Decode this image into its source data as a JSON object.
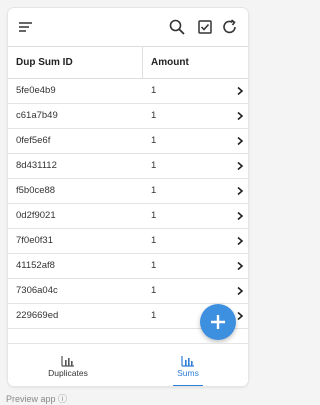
{
  "toolbar": {
    "icons": {
      "menu": "menu-icon",
      "search": "search-icon",
      "checkbox": "checkbox-icon",
      "refresh": "refresh-icon"
    }
  },
  "table": {
    "columns": [
      "Dup Sum ID",
      "Amount"
    ],
    "rows": [
      {
        "id": "5fe0e4b9",
        "amount": "1"
      },
      {
        "id": "c61a7b49",
        "amount": "1"
      },
      {
        "id": "0fef5e6f",
        "amount": "1"
      },
      {
        "id": "8d431112",
        "amount": "1"
      },
      {
        "id": "f5b0ce88",
        "amount": "1"
      },
      {
        "id": "0d2f9021",
        "amount": "1"
      },
      {
        "id": "7f0e0f31",
        "amount": "1"
      },
      {
        "id": "41152af8",
        "amount": "1"
      },
      {
        "id": "7306a04c",
        "amount": "1"
      },
      {
        "id": "229669ed",
        "amount": "1"
      }
    ]
  },
  "fab": {
    "icon": "plus-icon",
    "color": "#3d8fe0"
  },
  "bottom_nav": {
    "items": [
      {
        "label": "Duplicates",
        "icon": "bar-chart-icon",
        "active": false
      },
      {
        "label": "Sums",
        "icon": "bar-chart-icon",
        "active": true
      }
    ],
    "active_color": "#2f7fd8"
  },
  "caption": {
    "text": "Preview app ⓘ"
  }
}
